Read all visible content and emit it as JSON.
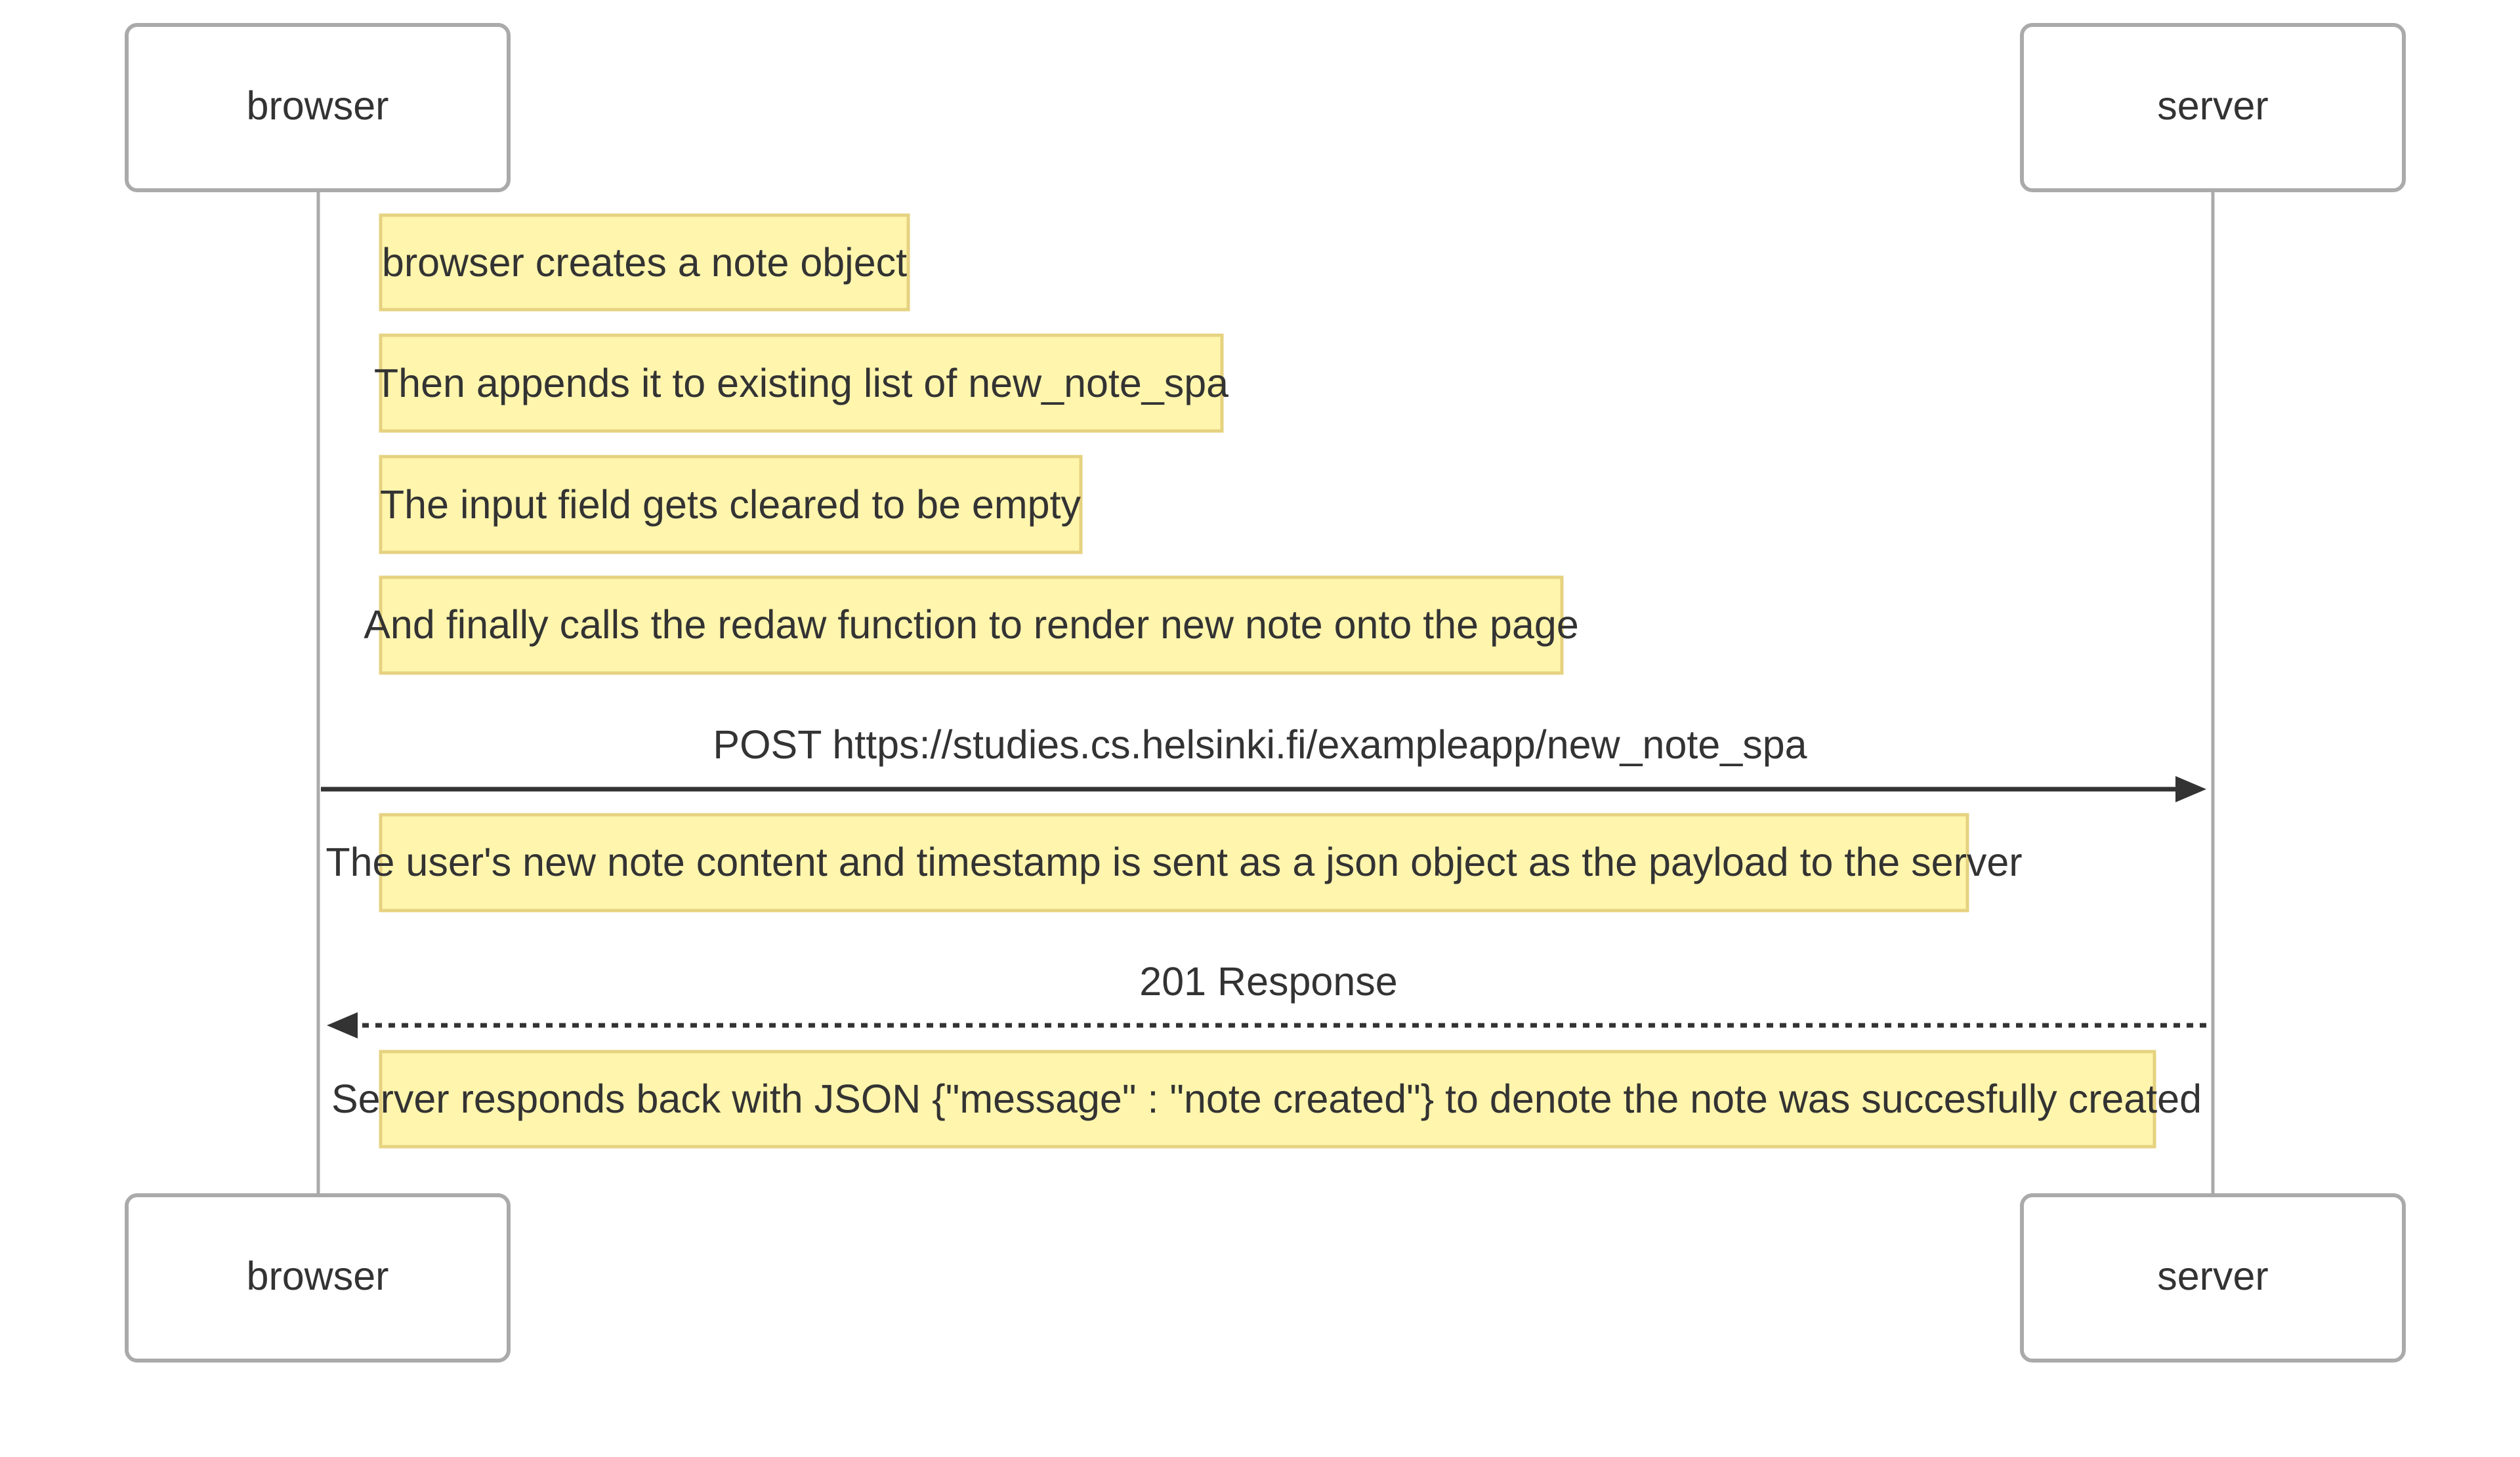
{
  "participants": {
    "browser": "browser",
    "server": "server"
  },
  "notes": [
    "browser creates a note object",
    "Then appends it to existing list of new_note_spa",
    "The input field gets cleared to be empty",
    "And finally calls the redaw function to render new note onto the page",
    "The user's new note content and timestamp is sent as a json object as the payload to the server",
    "Server responds back with JSON {\"message\" : \"note created\"} to denote the note was succesfully created"
  ],
  "messages": [
    {
      "label": "POST https://studies.cs.helsinki.fi/exampleapp/new_note_spa",
      "from": "browser",
      "to": "server",
      "style": "solid"
    },
    {
      "label": "201 Response",
      "from": "server",
      "to": "browser",
      "style": "dotted"
    }
  ],
  "colors": {
    "note_fill": "#fff5ad",
    "note_border": "#e6d280",
    "actor_border": "#aaaaaa",
    "text": "#333333"
  }
}
